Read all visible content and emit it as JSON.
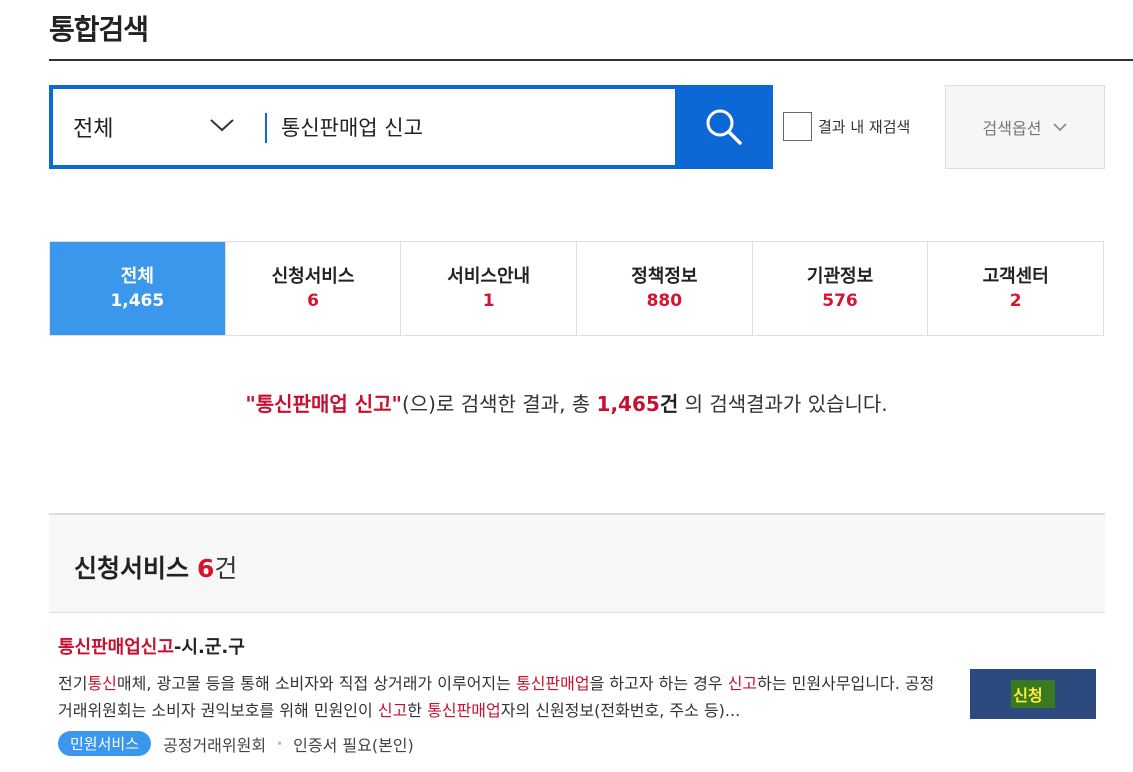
{
  "page_title": "통합검색",
  "search": {
    "scope": "전체",
    "query": "통신판매업 신고",
    "research_label": "결과 내 재검색",
    "options_label": "검색옵션"
  },
  "tabs": [
    {
      "label": "전체",
      "count": "1,465",
      "active": true
    },
    {
      "label": "신청서비스",
      "count": "6",
      "active": false
    },
    {
      "label": "서비스안내",
      "count": "1",
      "active": false
    },
    {
      "label": "정책정보",
      "count": "880",
      "active": false
    },
    {
      "label": "기관정보",
      "count": "576",
      "active": false
    },
    {
      "label": "고객센터",
      "count": "2",
      "active": false
    }
  ],
  "summary": {
    "open_quote": "\"",
    "keyword": "통신판매업 신고",
    "close_quote": "\"",
    "text1": "(으)로 검색한 결과, 총 ",
    "total": "1,465",
    "unit": "건",
    "text2": " 의 검색결과가 있습니다."
  },
  "section": {
    "title": "신청서비스",
    "count": "6",
    "unit": "건"
  },
  "result": {
    "title_highlight": "통신판매업신고",
    "title_rest": "-시.군.구",
    "desc": [
      {
        "t": "전기",
        "h": false
      },
      {
        "t": "통신",
        "h": true
      },
      {
        "t": "매체, 광고물 등을 통해 소비자와 직접 상거래가 이루어지는 ",
        "h": false
      },
      {
        "t": "통신판매업",
        "h": true
      },
      {
        "t": "을 하고자 하는 경우 ",
        "h": false
      },
      {
        "t": "신고",
        "h": true
      },
      {
        "t": "하는 민원사무입니다. 공정거래위원회는 소비자 권익보호를 위해 민원인이 ",
        "h": false
      },
      {
        "t": "신고",
        "h": true
      },
      {
        "t": "한 ",
        "h": false
      },
      {
        "t": "통신판매업",
        "h": true
      },
      {
        "t": "자의 신원정보(전화번호, 주소 등)...",
        "h": false
      }
    ],
    "badge": "민원서비스",
    "agency": "공정거래위원회",
    "requirement": "인증서 필요(본인)",
    "apply_label": "신청"
  },
  "colors": {
    "primary_blue": "#0b68d4",
    "tab_active": "#3a97ec",
    "highlight_red": "#c8102e",
    "apply_bg": "#2c4a7e"
  }
}
